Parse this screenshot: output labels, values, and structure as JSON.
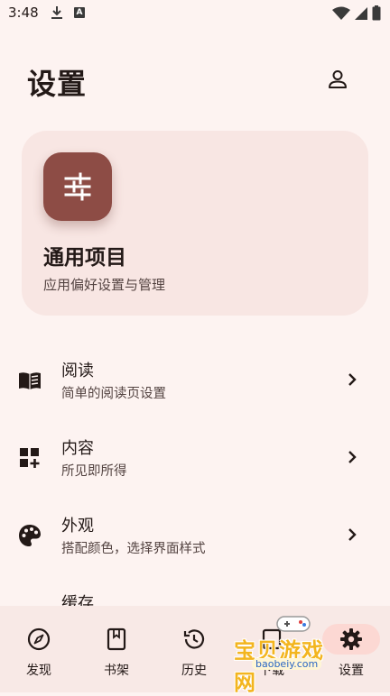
{
  "status_bar": {
    "time": "3:48",
    "a_icon_label": "A"
  },
  "header": {
    "title": "设置"
  },
  "hero": {
    "title": "通用项目",
    "subtitle": "应用偏好设置与管理"
  },
  "list": [
    {
      "title": "阅读",
      "subtitle": "简单的阅读页设置",
      "icon": "book-open-icon"
    },
    {
      "title": "内容",
      "subtitle": "所见即所得",
      "icon": "dashboard-add-icon"
    },
    {
      "title": "外观",
      "subtitle": "搭配颜色，选择界面样式",
      "icon": "palette-icon"
    },
    {
      "title": "缓存",
      "subtitle": "",
      "icon": ""
    }
  ],
  "bottom_nav": [
    {
      "label": "发现",
      "icon": "compass-icon"
    },
    {
      "label": "书架",
      "icon": "bookmark-book-icon"
    },
    {
      "label": "历史",
      "icon": "history-icon"
    },
    {
      "label": "下载",
      "icon": "download-box-icon"
    },
    {
      "label": "设置",
      "icon": "gear-icon",
      "selected": true
    }
  ],
  "watermark": {
    "text": "宝贝游戏网",
    "url": "baobeiy.com"
  },
  "colors": {
    "background": "#fdf3f1",
    "accent": "#8d4c45",
    "card": "#f8e6e3",
    "nav_pill": "#fcd8d3"
  }
}
